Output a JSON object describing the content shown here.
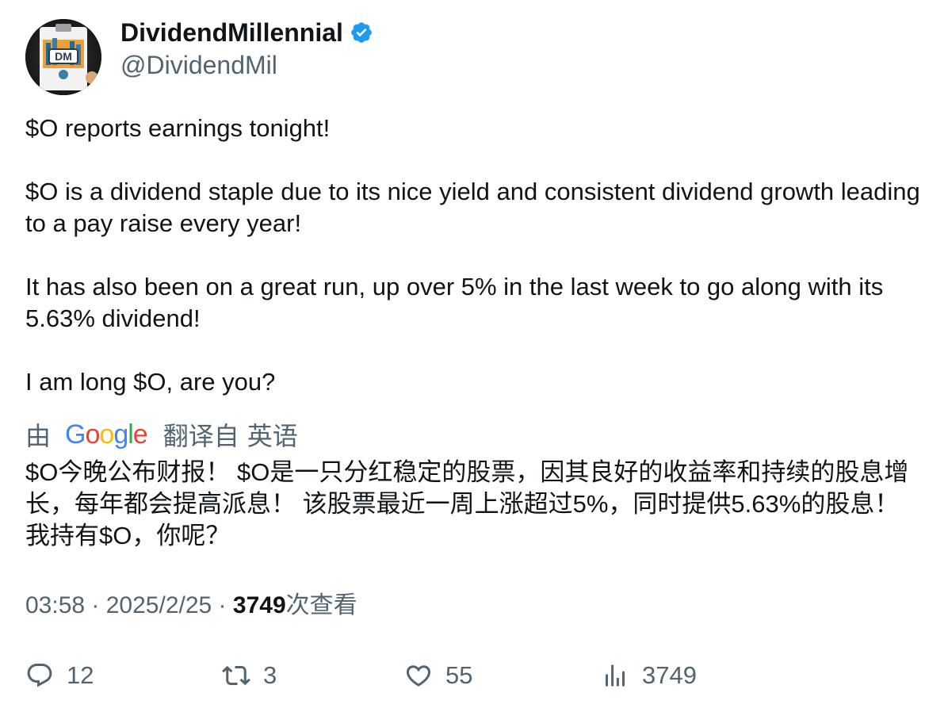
{
  "author": {
    "display_name": "DividendMillennial",
    "handle": "@DividendMil",
    "avatar_text": "DM",
    "verified_icon": "verified-badge-icon"
  },
  "tweet": {
    "line1": "$O reports earnings tonight!",
    "line2": "$O is a dividend staple due to its nice yield and consistent dividend growth leading to a pay raise every year!",
    "line3": "It has also been on a great run, up over 5% in the last week to go along with its 5.63% dividend!",
    "line4": "I am long $O, are you?"
  },
  "translation": {
    "by_label": "由",
    "provider": "Google",
    "from_label": "翻译自",
    "source_language": "英语",
    "text": "$O今晚公布财报！ $O是一只分红稳定的股票，因其良好的收益率和持续的股息增长，每年都会提高派息！ 该股票最近一周上涨超过5%，同时提供5.63%的股息！ 我持有$O，你呢？"
  },
  "meta": {
    "time": "03:58",
    "sep1": " · ",
    "date": "2025/2/25",
    "sep2": " · ",
    "views": "3749",
    "views_label": "次查看"
  },
  "actions": {
    "replies": "12",
    "retweets": "3",
    "likes": "55",
    "views": "3749"
  },
  "colors": {
    "text_primary": "#0f1419",
    "text_secondary": "#536471",
    "verified_blue": "#1d9bf0"
  }
}
